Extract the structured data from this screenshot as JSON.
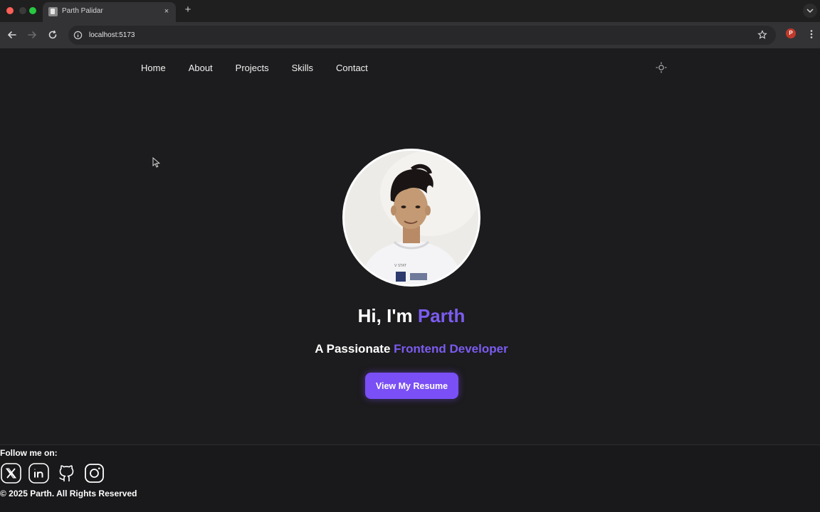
{
  "browser": {
    "tab_title": "Parth Palidar",
    "tab_close": "×",
    "new_tab": "+",
    "url": "localhost:5173",
    "profile_initial": "P"
  },
  "nav": {
    "items": [
      {
        "label": "Home"
      },
      {
        "label": "About"
      },
      {
        "label": "Projects"
      },
      {
        "label": "Skills"
      },
      {
        "label": "Contact"
      }
    ],
    "theme_icon": "sun-icon"
  },
  "hero": {
    "greeting_prefix": "Hi, I'm ",
    "name": "Parth",
    "tagline_prefix": "A Passionate ",
    "role": "Frontend Developer",
    "cta_label": "View My Resume",
    "accent_color": "#7b5cf0",
    "button_color": "#7a4ff5"
  },
  "footer": {
    "follow_label": "Follow me on:",
    "socials": [
      {
        "icon": "x-twitter-icon"
      },
      {
        "icon": "linkedin-icon"
      },
      {
        "icon": "github-icon"
      },
      {
        "icon": "instagram-icon"
      }
    ],
    "copyright": "© 2025 Parth. All Rights Reserved"
  }
}
